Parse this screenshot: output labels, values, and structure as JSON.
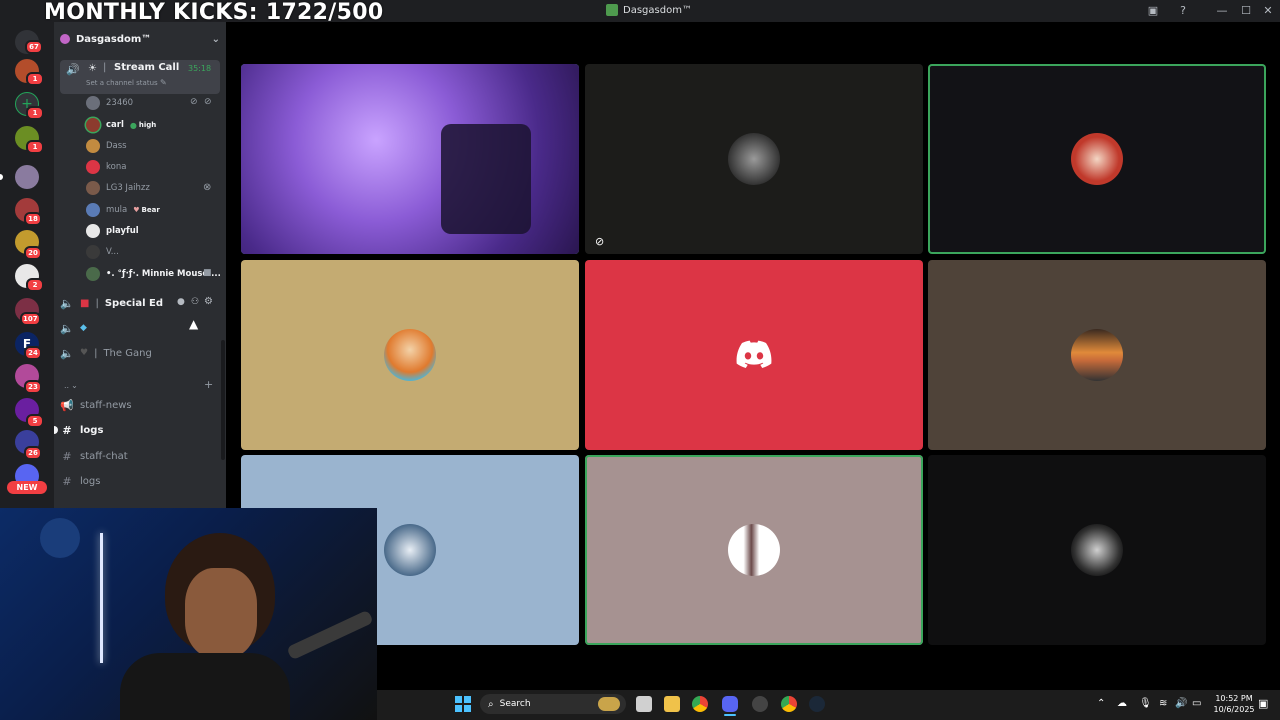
{
  "overlay": {
    "title": "MONTHLY KICKS: 1722/500"
  },
  "window": {
    "title": "Dasgasdom™"
  },
  "rail": {
    "badges": [
      "67",
      "1",
      "1",
      "1",
      "18",
      "20",
      "2",
      "107",
      "24",
      "23",
      "5",
      "26"
    ],
    "new_label": "NEW"
  },
  "server": {
    "name": "Dasgasdom™"
  },
  "channels": {
    "stream_call": {
      "name": "Stream Call",
      "timer": "35:18",
      "status": "Set a channel status"
    },
    "voice_users": [
      {
        "name": "23460"
      },
      {
        "name": "carl",
        "tag": "high"
      },
      {
        "name": "Dass"
      },
      {
        "name": "kona"
      },
      {
        "name": "LG3 Jaihzz"
      },
      {
        "name": "mula",
        "tag": "Bear"
      },
      {
        "name": "playful"
      },
      {
        "name": "V..."
      },
      {
        "name": "•. °ƒ·ƒ·. Minnie Mouse ..."
      }
    ],
    "special_ed": {
      "name": "Special Ed"
    },
    "the_gang": {
      "name": "The Gang"
    },
    "category": "..",
    "text_channels": [
      {
        "name": "staff-news"
      },
      {
        "name": "logs"
      },
      {
        "name": "staff-chat"
      },
      {
        "name": "logs"
      }
    ]
  },
  "grid": {
    "tiles": [
      {
        "bg": "#6b3fb0"
      },
      {
        "bg": "#1c1c1a"
      },
      {
        "bg": "#121216"
      },
      {
        "bg": "#c4ab72"
      },
      {
        "bg": "#dc3545"
      },
      {
        "bg": "#4f4339"
      },
      {
        "bg": "#9ab4cf"
      },
      {
        "bg": "#a69291"
      },
      {
        "bg": "#0f0f10"
      }
    ]
  },
  "taskbar": {
    "search_placeholder": "Search",
    "time": "10:52 PM",
    "date": "10/6/2025"
  },
  "colors": {
    "accent_green": "#3ba55c",
    "discord_red": "#dc3545",
    "blurple": "#5865f2"
  }
}
